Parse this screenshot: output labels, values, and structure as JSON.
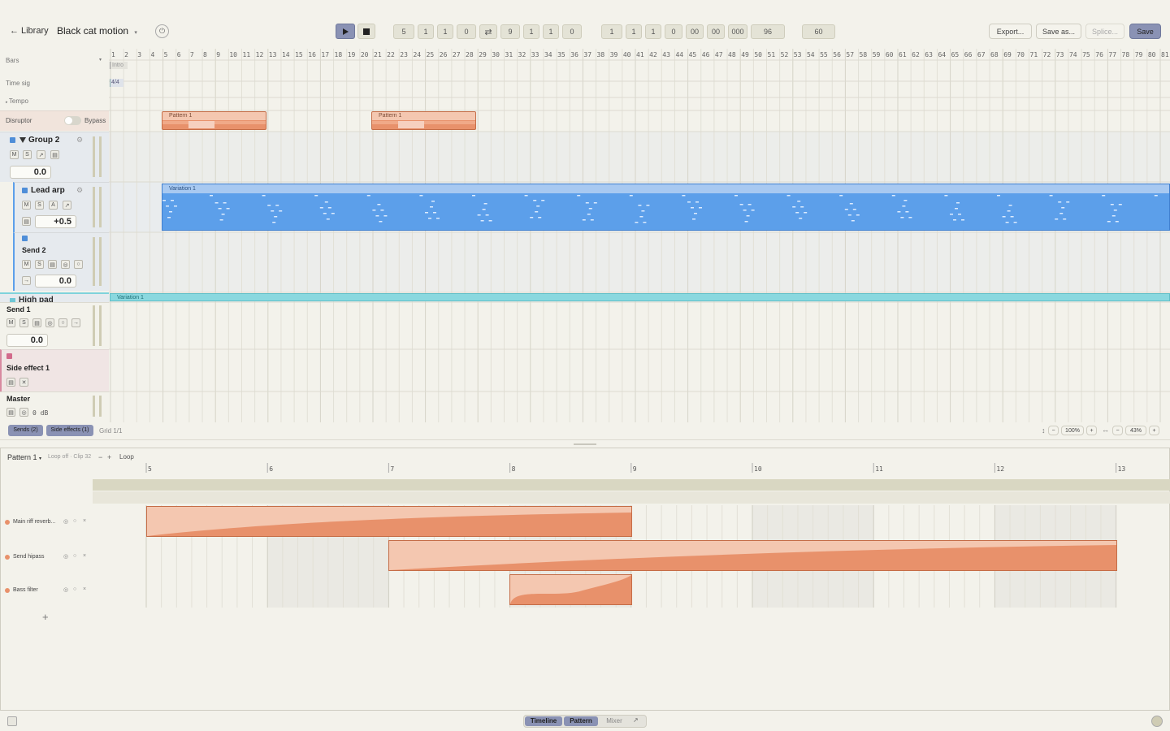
{
  "header": {
    "back": "Library",
    "title": "Black cat motion",
    "caret": "▾"
  },
  "transport": {
    "counters": [
      "5",
      "1",
      "1",
      "0",
      "9",
      "1",
      "1",
      "0"
    ],
    "position": [
      "1",
      "1",
      "1",
      "0",
      "00",
      "00",
      "000",
      "96"
    ],
    "tempo_box": "60"
  },
  "actions": {
    "export": "Export...",
    "save_as": "Save as...",
    "splice": "Splice...",
    "save": "Save"
  },
  "ruler": {
    "bars": [
      "1",
      "2",
      "3",
      "4",
      "5",
      "6",
      "7",
      "8",
      "9",
      "10",
      "11",
      "12",
      "13",
      "14",
      "15",
      "16",
      "17",
      "18",
      "19",
      "20",
      "21",
      "22",
      "23",
      "24",
      "25",
      "26",
      "27",
      "28",
      "29",
      "30",
      "31",
      "32",
      "33",
      "34",
      "35",
      "36",
      "37",
      "38",
      "39",
      "40",
      "41",
      "42",
      "43",
      "44",
      "45",
      "46",
      "47",
      "48",
      "49",
      "50",
      "51",
      "52",
      "53",
      "54",
      "55",
      "56",
      "57",
      "58",
      "59",
      "60",
      "61",
      "62",
      "63",
      "64",
      "65",
      "66",
      "67",
      "68",
      "69",
      "70",
      "71",
      "72",
      "73",
      "74",
      "75",
      "76",
      "77",
      "78",
      "79",
      "80",
      "81"
    ]
  },
  "lanes": {
    "bars": "Bars",
    "time_sig": "Time sig",
    "tempo": "Tempo",
    "intro_marker": "Intro",
    "time_sig_value": "4/4"
  },
  "disruptor": {
    "name": "Disruptor",
    "bypass": "Bypass",
    "clips": [
      "Pattern 1",
      "Pattern 1"
    ]
  },
  "tracks": {
    "group2": {
      "name": "Group 2",
      "value": "0.0",
      "buttons": [
        "M",
        "S",
        "↗",
        "▤"
      ]
    },
    "lead_arp": {
      "name": "Lead arp",
      "value": "+0.5",
      "buttons": [
        "M",
        "S",
        "A",
        "↗",
        "▤"
      ],
      "clip": "Variation 1"
    },
    "send2": {
      "name": "Send 2",
      "value": "0.0",
      "buttons": [
        "M",
        "S",
        "▤",
        "◎",
        "○",
        "→"
      ]
    },
    "high_pad": {
      "name": "High pad",
      "clip": "Variation 1"
    },
    "send1": {
      "name": "Send 1",
      "value": "0.0",
      "buttons": [
        "M",
        "S",
        "▤",
        "◎",
        "○",
        "→"
      ]
    },
    "side_effect1": {
      "name": "Side effect 1",
      "buttons": [
        "▤",
        "✕"
      ]
    },
    "master": {
      "name": "Master",
      "db": "0 dB",
      "buttons": [
        "▤",
        "◎"
      ]
    }
  },
  "footer_bar": {
    "sends": "Sends (2)",
    "side_effects": "Side effects (1)",
    "grid": "Grid 1/1",
    "zoom_v": "100%",
    "zoom_h": "43%"
  },
  "pattern": {
    "name": "Pattern 1",
    "caret": "▾",
    "info": "Loop off · Clip 32",
    "minus": "−",
    "plus": "+",
    "loop": "Loop",
    "ruler": [
      "5",
      "6",
      "7",
      "8",
      "9",
      "10",
      "11",
      "12",
      "13"
    ],
    "lanes": [
      {
        "name": "Main riff reverb..."
      },
      {
        "name": "Send hipass"
      },
      {
        "name": "Bass filter"
      }
    ],
    "add": "+"
  },
  "colors": {
    "orange": "#e8916b",
    "orange_light": "#f4c7b0",
    "blue": "#5c9fea",
    "cyan": "#7fd3db",
    "accent": "#4d5d86"
  },
  "bottom_tabs": {
    "timeline": "Timeline",
    "pattern": "Pattern",
    "mixer": "Mixer"
  }
}
